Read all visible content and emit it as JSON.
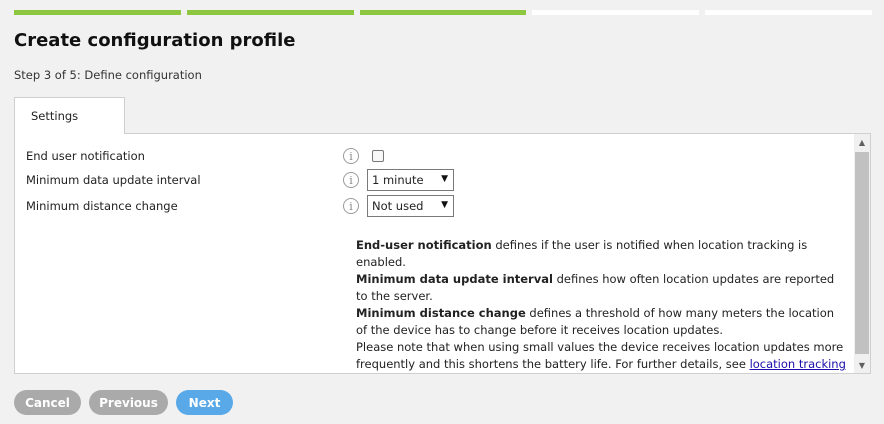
{
  "wizard": {
    "total_steps": 5,
    "completed_steps": 3
  },
  "header": {
    "title": "Create configuration profile",
    "step_text": "Step 3 of 5: Define configuration"
  },
  "tabs": [
    {
      "label": "Settings",
      "active": true
    }
  ],
  "settings": {
    "end_user_notification": {
      "label": "End user notification",
      "checked": false
    },
    "min_update_interval": {
      "label": "Minimum data update interval",
      "value": "1 minute"
    },
    "min_distance_change": {
      "label": "Minimum distance change",
      "value": "Not used"
    }
  },
  "help": {
    "p1_bold": "End-user notification",
    "p1_text": " defines if the user is notified when location tracking is enabled.",
    "p2_bold": "Minimum data update interval",
    "p2_text": " defines how often location updates are reported to the server.",
    "p3_bold": "Minimum distance change",
    "p3_text": " defines a threshold of how many meters the location of the device has to change before it receives location updates.",
    "p4_text": "Please note that when using small values the device receives location updates more frequently and this shortens the battery life. For further details, see ",
    "link_text": "location tracking documentation"
  },
  "icons": {
    "info": "info-circle-icon",
    "caret": "caret-down-icon"
  },
  "buttons": {
    "cancel": "Cancel",
    "previous": "Previous",
    "next": "Next"
  },
  "colors": {
    "progress_done": "#8dc63f",
    "progress_todo": "#ffffff",
    "next_button": "#59a9e8",
    "gray_button": "#aaaaaa"
  }
}
